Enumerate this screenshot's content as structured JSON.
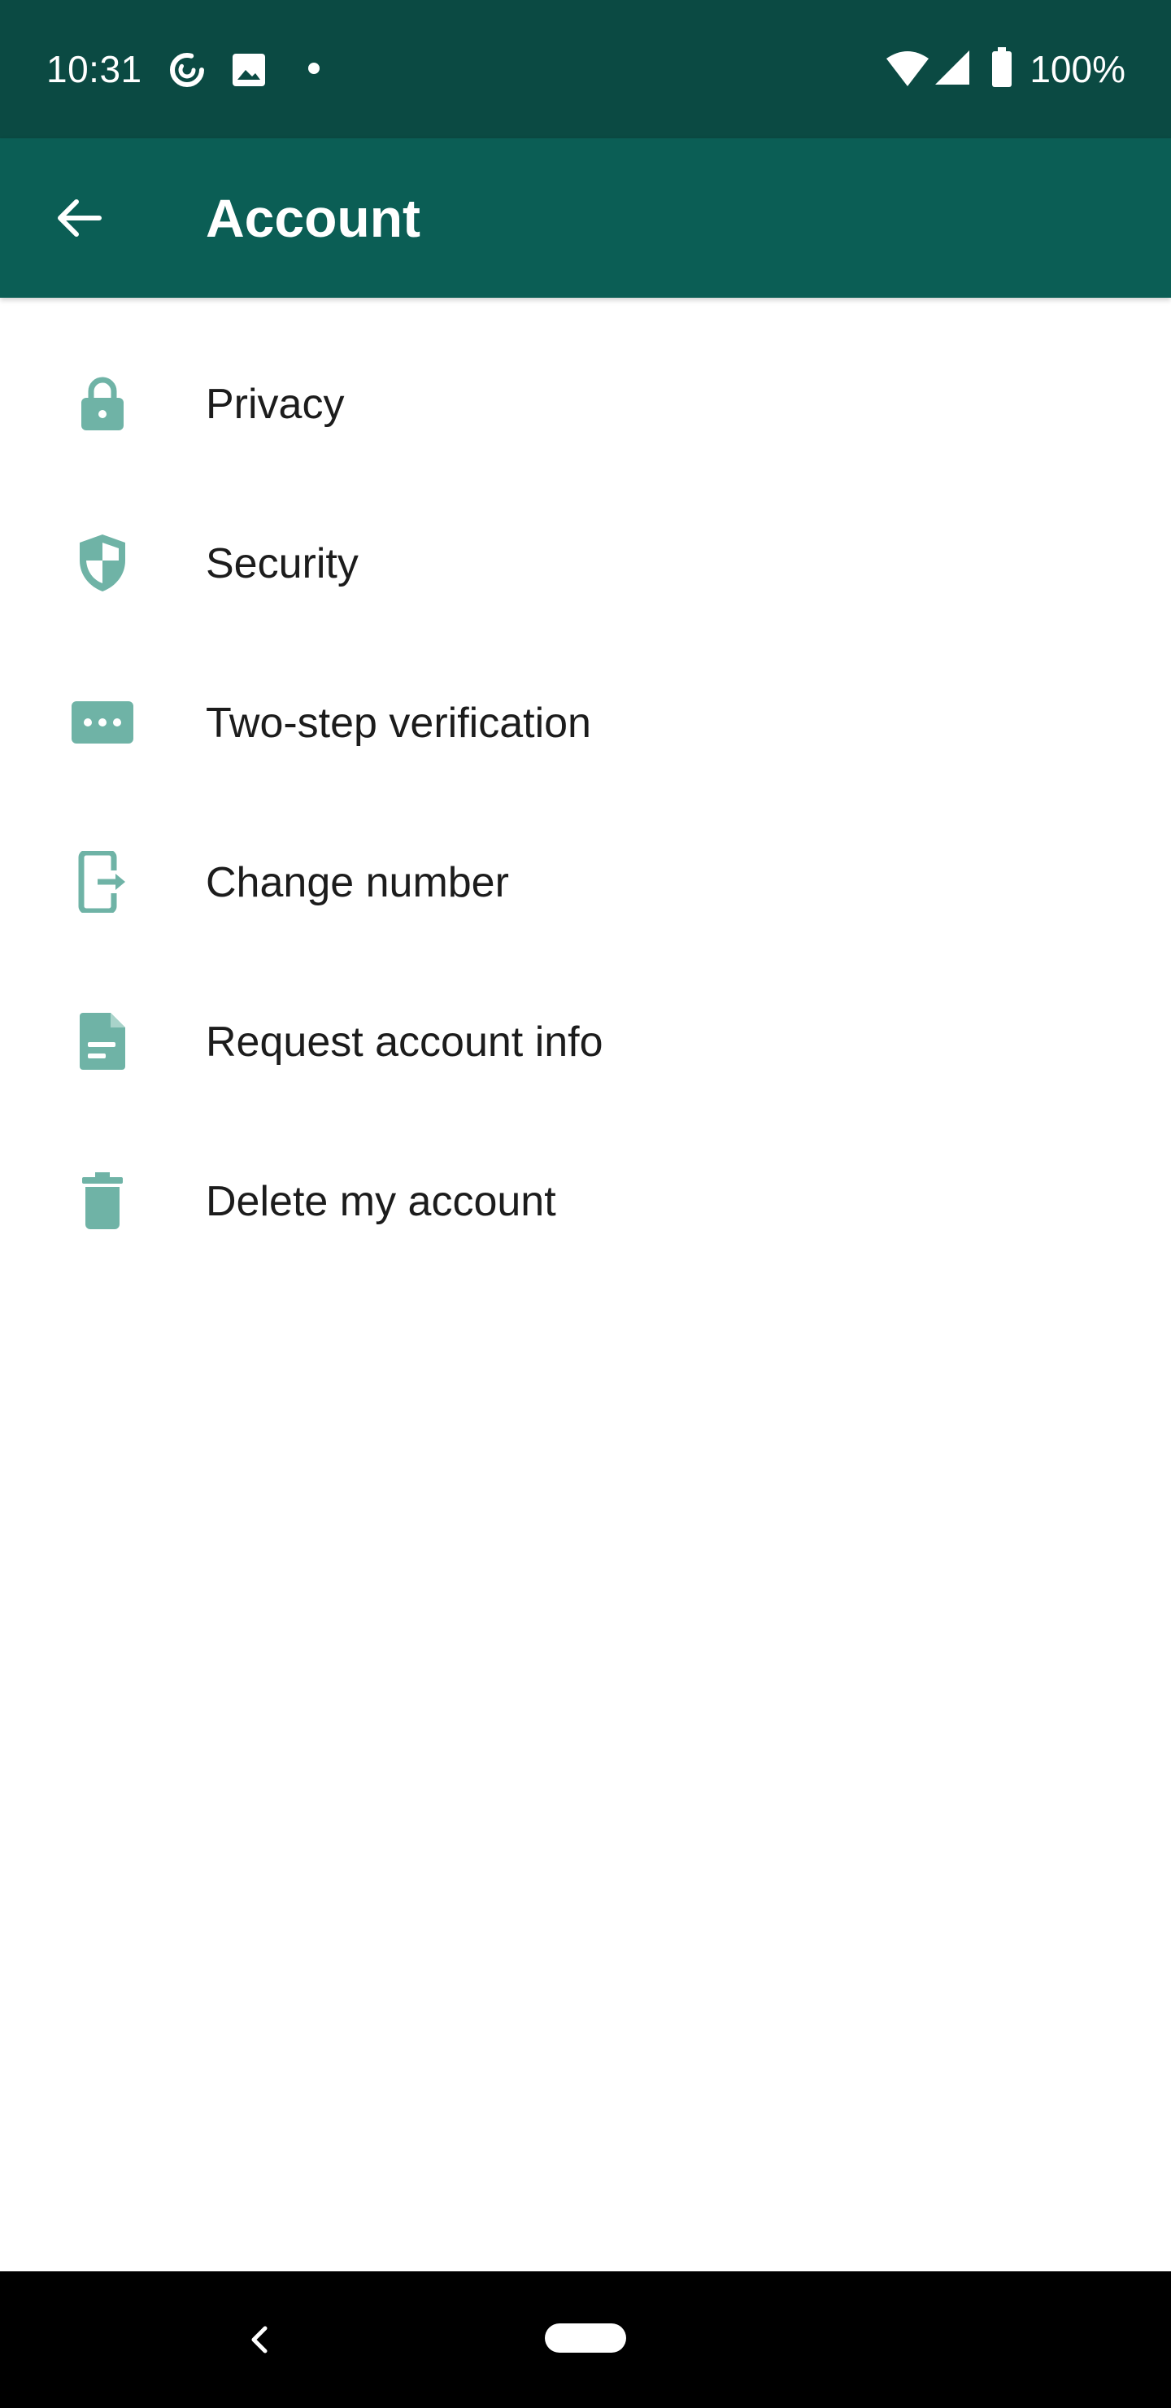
{
  "status_bar": {
    "time": "10:31",
    "battery": "100%",
    "icons": [
      "sync-icon",
      "image-icon",
      "notification-dot-icon",
      "wifi-icon",
      "cell-signal-icon",
      "battery-icon"
    ]
  },
  "app_bar": {
    "title": "Account",
    "back_icon": "arrow-back-icon"
  },
  "menu": {
    "items": [
      {
        "label": "Privacy",
        "icon": "lock-icon"
      },
      {
        "label": "Security",
        "icon": "shield-icon"
      },
      {
        "label": "Two-step verification",
        "icon": "password-dots-icon"
      },
      {
        "label": "Change number",
        "icon": "phone-transfer-icon"
      },
      {
        "label": "Request account info",
        "icon": "document-icon"
      },
      {
        "label": "Delete my account",
        "icon": "trash-icon"
      }
    ]
  },
  "nav_bar": {
    "icons": [
      "back-chevron-icon",
      "home-pill-icon"
    ]
  },
  "colors": {
    "status_bar": "#0b4a43",
    "app_bar": "#0b5e55",
    "icon_tint": "#6fb3a6",
    "text_primary": "#1c1c1c"
  }
}
